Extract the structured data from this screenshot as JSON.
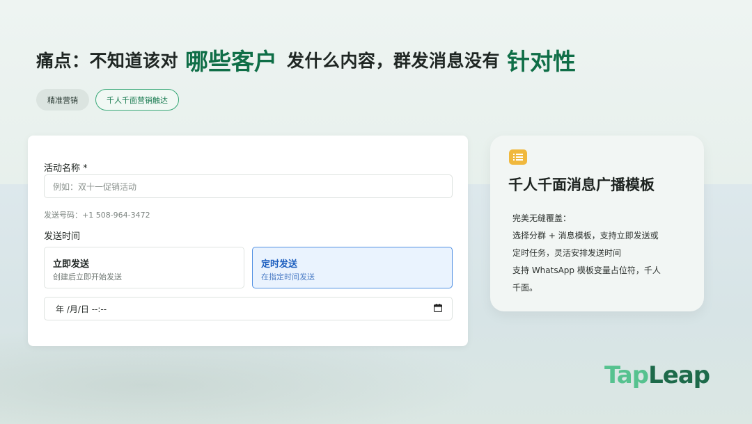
{
  "headline": {
    "part1": "痛点：不知道该对",
    "highlight1": "哪些客户",
    "part2": "发什么内容，群发消息没有",
    "highlight2": "针对性"
  },
  "chips": [
    {
      "label": "精准营销"
    },
    {
      "label": "千人千面营销触达"
    }
  ],
  "form": {
    "name_label": "活动名称 *",
    "name_placeholder": "例如：双十一促销活动",
    "sender_hint": "发送号码：+1 508-964-3472",
    "time_label": "发送时间",
    "options": [
      {
        "title": "立即发送",
        "sub": "创建后立即开始发送",
        "selected": false
      },
      {
        "title": "定时发送",
        "sub": "在指定时间发送",
        "selected": true
      }
    ],
    "date_value": "年 /月/日  --:--"
  },
  "info": {
    "title": "千人千面消息广播模板",
    "lines": [
      "完美无缝覆盖：",
      "选择分群 + 消息模板，支持立即发送或",
      "定时任务，灵活安排发送时间",
      "支持 WhatsApp 模板变量占位符，千人",
      "千面。"
    ]
  },
  "brand": {
    "part1": "Tap",
    "part2": "Leap"
  },
  "colors": {
    "accent_green": "#0f6e47",
    "selected_blue": "#4f8fe2",
    "icon_yellow": "#f0b83d"
  }
}
